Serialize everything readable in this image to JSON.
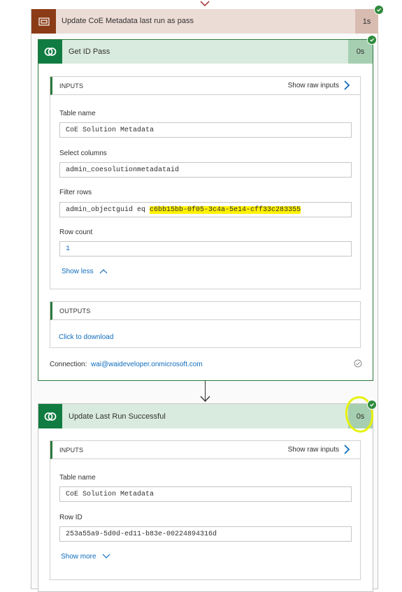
{
  "scope": {
    "title": "Update CoE Metadata last run as pass",
    "duration": "1s"
  },
  "action1": {
    "title": "Get ID Pass",
    "duration": "0s",
    "inputs": {
      "heading": "INPUTS",
      "raw_link": "Show raw inputs",
      "fields": [
        {
          "label": "Table name",
          "value": "CoE Solution Metadata"
        },
        {
          "label": "Select columns",
          "value": "admin_coesolutionmetadataid"
        },
        {
          "label": "Filter rows",
          "value_prefix": "admin_objectguid eq ",
          "value_highlight": "c6bb15bb-0f05-3c4a-5e14-cff33c283355"
        },
        {
          "label": "Row count",
          "value": "1"
        }
      ],
      "toggle": "Show less"
    },
    "outputs": {
      "heading": "OUTPUTS",
      "link": "Click to download"
    },
    "connection": {
      "label": "Connection:",
      "value": "wai@waideveloper.onmicrosoft.com"
    }
  },
  "action2": {
    "title": "Update Last Run Successful",
    "duration": "0s",
    "inputs": {
      "heading": "INPUTS",
      "raw_link": "Show raw inputs",
      "fields": [
        {
          "label": "Table name",
          "value": "CoE Solution Metadata"
        },
        {
          "label": "Row ID",
          "value": "253a55a9-5d0d-ed11-b83e-00224894316d"
        }
      ],
      "toggle": "Show more"
    }
  },
  "icons": {
    "scope": "scope-icon",
    "dataverse": "dataverse-icon",
    "success": "check-circle-icon",
    "chevron": "chevron-right-icon"
  },
  "colors": {
    "scope_header": "#ecdcd6",
    "scope_icon": "#8b3b16",
    "action_header": "#d9ebde",
    "dataverse": "#107c41",
    "success": "#2e8b3c",
    "link": "#0f6cbd",
    "highlight": "#fff100"
  }
}
